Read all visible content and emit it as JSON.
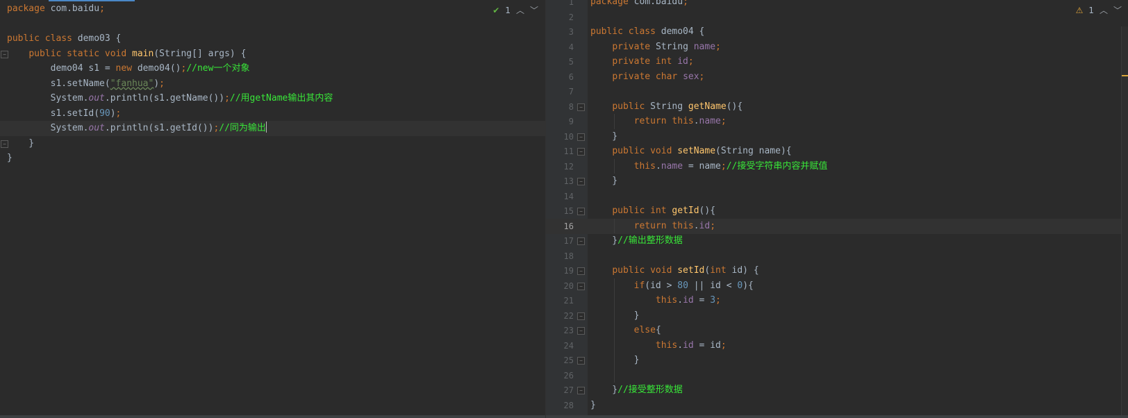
{
  "left_editor": {
    "inspection_count": "1",
    "lines": [
      {
        "parts": [
          [
            "kw",
            "package "
          ],
          [
            "",
            "com.baidu"
          ],
          [
            "kw",
            ";"
          ]
        ]
      },
      {
        "parts": []
      },
      {
        "parts": [
          [
            "kw",
            "public class "
          ],
          [
            "",
            "demo03 {"
          ]
        ]
      },
      {
        "parts": [
          [
            "",
            "    "
          ],
          [
            "kw",
            "public static void "
          ],
          [
            "fn",
            "main"
          ],
          [
            "",
            "(String[] args) {"
          ]
        ]
      },
      {
        "parts": [
          [
            "",
            "        demo04 s1 = "
          ],
          [
            "kw",
            "new "
          ],
          [
            "",
            "demo04()"
          ],
          [
            "kw",
            ";"
          ],
          [
            "cmt",
            "//new一个对象"
          ]
        ]
      },
      {
        "parts": [
          [
            "",
            "        s1.setName("
          ],
          [
            "str",
            "\"fanhua\""
          ],
          [
            "",
            ")"
          ],
          [
            "kw",
            ";"
          ]
        ]
      },
      {
        "parts": [
          [
            "",
            "        System."
          ],
          [
            "fld ital",
            "out"
          ],
          [
            "",
            ".println(s1.getName())"
          ],
          [
            "kw",
            ";"
          ],
          [
            "cmt",
            "//用getName输出其内容"
          ]
        ]
      },
      {
        "parts": [
          [
            "",
            "        s1.setId("
          ],
          [
            "num",
            "90"
          ],
          [
            "",
            ")"
          ],
          [
            "kw",
            ";"
          ]
        ]
      },
      {
        "parts": [
          [
            "",
            "        System."
          ],
          [
            "fld ital",
            "out"
          ],
          [
            "",
            ".println(s1.getId())"
          ],
          [
            "kw",
            ";"
          ],
          [
            "cmt",
            "//同为输出"
          ]
        ],
        "caret": true
      },
      {
        "parts": [
          [
            "",
            "    }"
          ]
        ]
      },
      {
        "parts": [
          [
            "",
            "}"
          ]
        ]
      }
    ]
  },
  "right_editor": {
    "inspection_count": "1",
    "active_line": 16,
    "lines": [
      {
        "n": 1,
        "parts": [
          [
            "kw",
            "package "
          ],
          [
            "",
            "com.baidu"
          ],
          [
            "kw",
            ";"
          ]
        ]
      },
      {
        "n": 2,
        "parts": []
      },
      {
        "n": 3,
        "parts": [
          [
            "kw",
            "public class "
          ],
          [
            "",
            "demo04 {"
          ]
        ]
      },
      {
        "n": 4,
        "parts": [
          [
            "",
            "    "
          ],
          [
            "kw",
            "private "
          ],
          [
            "",
            "String "
          ],
          [
            "fld",
            "name"
          ],
          [
            "kw",
            ";"
          ]
        ]
      },
      {
        "n": 5,
        "parts": [
          [
            "",
            "    "
          ],
          [
            "kw",
            "private int "
          ],
          [
            "fld",
            "id"
          ],
          [
            "kw",
            ";"
          ]
        ]
      },
      {
        "n": 6,
        "parts": [
          [
            "",
            "    "
          ],
          [
            "kw",
            "private char "
          ],
          [
            "fld",
            "sex"
          ],
          [
            "kw",
            ";"
          ]
        ]
      },
      {
        "n": 7,
        "parts": []
      },
      {
        "n": 8,
        "parts": [
          [
            "",
            "    "
          ],
          [
            "kw",
            "public "
          ],
          [
            "",
            "String "
          ],
          [
            "fn",
            "getName"
          ],
          [
            "",
            "(){"
          ]
        ]
      },
      {
        "n": 9,
        "parts": [
          [
            "",
            "        "
          ],
          [
            "kw",
            "return this"
          ],
          [
            "",
            "."
          ],
          [
            "fld",
            "name"
          ],
          [
            "kw",
            ";"
          ]
        ]
      },
      {
        "n": 10,
        "parts": [
          [
            "",
            "    }"
          ]
        ]
      },
      {
        "n": 11,
        "parts": [
          [
            "",
            "    "
          ],
          [
            "kw",
            "public void "
          ],
          [
            "fn",
            "setName"
          ],
          [
            "",
            "(String name){"
          ]
        ]
      },
      {
        "n": 12,
        "parts": [
          [
            "",
            "        "
          ],
          [
            "kw",
            "this"
          ],
          [
            "",
            "."
          ],
          [
            "fld",
            "name"
          ],
          [
            "",
            " = name"
          ],
          [
            "kw",
            ";"
          ],
          [
            "cmt",
            "//接受字符串内容并赋值"
          ]
        ]
      },
      {
        "n": 13,
        "parts": [
          [
            "",
            "    }"
          ]
        ]
      },
      {
        "n": 14,
        "parts": []
      },
      {
        "n": 15,
        "parts": [
          [
            "",
            "    "
          ],
          [
            "kw",
            "public int "
          ],
          [
            "fn",
            "getId"
          ],
          [
            "",
            "(){"
          ]
        ]
      },
      {
        "n": 16,
        "parts": [
          [
            "",
            "        "
          ],
          [
            "kw",
            "return this"
          ],
          [
            "",
            "."
          ],
          [
            "fld",
            "id"
          ],
          [
            "kw",
            ";"
          ]
        ]
      },
      {
        "n": 17,
        "parts": [
          [
            "",
            "    }"
          ],
          [
            "cmt",
            "//输出整形数据"
          ]
        ]
      },
      {
        "n": 18,
        "parts": []
      },
      {
        "n": 19,
        "parts": [
          [
            "",
            "    "
          ],
          [
            "kw",
            "public void "
          ],
          [
            "fn",
            "setId"
          ],
          [
            "",
            "("
          ],
          [
            "kw",
            "int "
          ],
          [
            "",
            "id) {"
          ]
        ]
      },
      {
        "n": 20,
        "parts": [
          [
            "",
            "        "
          ],
          [
            "kw",
            "if"
          ],
          [
            "",
            "(id > "
          ],
          [
            "num",
            "80"
          ],
          [
            "",
            " || id < "
          ],
          [
            "num",
            "0"
          ],
          [
            "",
            "){"
          ]
        ]
      },
      {
        "n": 21,
        "parts": [
          [
            "",
            "            "
          ],
          [
            "kw",
            "this"
          ],
          [
            "",
            "."
          ],
          [
            "fld",
            "id"
          ],
          [
            "",
            " = "
          ],
          [
            "num",
            "3"
          ],
          [
            "kw",
            ";"
          ]
        ]
      },
      {
        "n": 22,
        "parts": [
          [
            "",
            "        }"
          ]
        ]
      },
      {
        "n": 23,
        "parts": [
          [
            "",
            "        "
          ],
          [
            "kw",
            "else"
          ],
          [
            "",
            "{"
          ]
        ]
      },
      {
        "n": 24,
        "parts": [
          [
            "",
            "            "
          ],
          [
            "kw",
            "this"
          ],
          [
            "",
            "."
          ],
          [
            "fld",
            "id"
          ],
          [
            "",
            " = id"
          ],
          [
            "kw",
            ";"
          ]
        ]
      },
      {
        "n": 25,
        "parts": [
          [
            "",
            "        }"
          ]
        ]
      },
      {
        "n": 26,
        "parts": []
      },
      {
        "n": 27,
        "parts": [
          [
            "",
            "    }"
          ],
          [
            "cmt",
            "//接受整形数据"
          ]
        ]
      },
      {
        "n": 28,
        "parts": [
          [
            "",
            "}"
          ]
        ]
      }
    ]
  }
}
